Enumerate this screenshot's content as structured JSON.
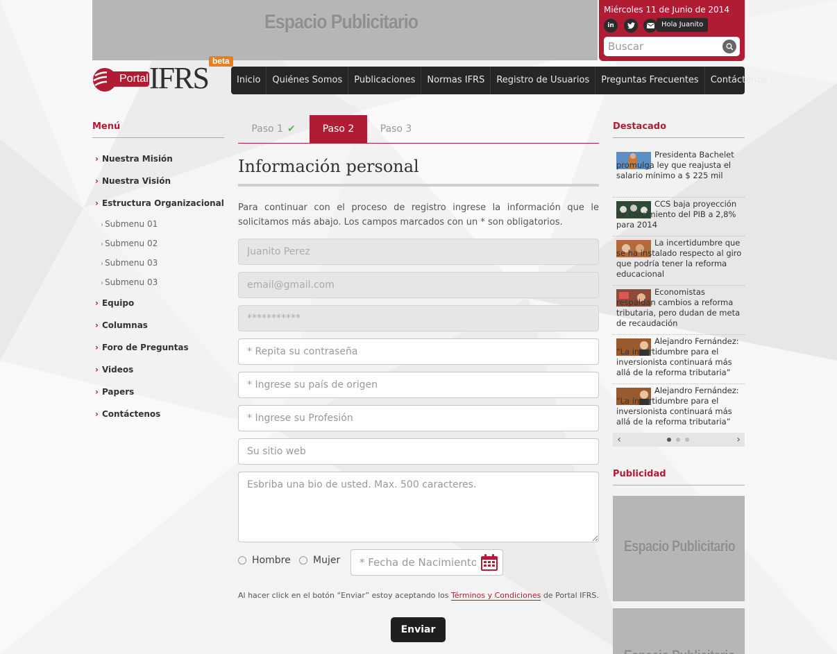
{
  "top_ad": {
    "text": "Espacio Publicitario"
  },
  "user_box": {
    "date": "Miércoles 11 de Junio de 2014",
    "social": [
      "in"
    ],
    "greeting": "Hola Juanito",
    "search_placeholder": "Buscar"
  },
  "logo": {
    "portal": "Portal",
    "ifrs": "IFRS",
    "beta": "beta"
  },
  "nav": [
    "Inicio",
    "Quiénes Somos",
    "Publicaciones",
    "Normas IFRS",
    "Registro de Usuarios",
    "Preguntas Frecuentes",
    "Contáctenos"
  ],
  "sidebar": {
    "heading": "Menú",
    "items": [
      {
        "label": "Nuestra Misión",
        "sub": false
      },
      {
        "label": "Nuestra Visión",
        "sub": false
      },
      {
        "label": "Estructura Organizacional",
        "sub": false
      },
      {
        "label": "Submenu 01",
        "sub": true
      },
      {
        "label": "Submenu 02",
        "sub": true
      },
      {
        "label": "Submenu 03",
        "sub": true
      },
      {
        "label": "Submenu 03",
        "sub": true
      },
      {
        "label": "Equipo",
        "sub": false
      },
      {
        "label": "Columnas",
        "sub": false
      },
      {
        "label": "Foro de Preguntas",
        "sub": false
      },
      {
        "label": "Videos",
        "sub": false
      },
      {
        "label": "Papers",
        "sub": false
      },
      {
        "label": "Contáctenos",
        "sub": false
      }
    ]
  },
  "steps": [
    {
      "label": "Paso 1",
      "done": true,
      "active": false
    },
    {
      "label": "Paso 2",
      "done": false,
      "active": true
    },
    {
      "label": "Paso 3",
      "done": false,
      "active": false
    }
  ],
  "form": {
    "title": "Información personal",
    "intro": "Para continuar con el proceso de registro ingrese la información que le solicitamos más abajo. Los campos marcados con un * son obligatorios.",
    "name_value": "Juanito Perez",
    "email_value": "email@gmail.com",
    "password_value": "***********",
    "repeat_password_placeholder": "* Repita su contraseña",
    "country_placeholder": "* Ingrese su país de origen",
    "profession_placeholder": "* Ingrese su Profesión",
    "website_placeholder": "Su sitio web",
    "bio_placeholder": "Esbriba una bio de usted. Max. 500 caracteres.",
    "gender_male": "Hombre",
    "gender_female": "Mujer",
    "birthdate_placeholder": "* Fecha de Nacimiento",
    "terms_prefix": "Al hacer click en el botón “Enviar” estoy aceptando los",
    "terms_link": "Términos y Condiciones",
    "terms_suffix": "de Portal IFRS.",
    "submit_label": "Enviar"
  },
  "right": {
    "featured_heading": "Destacado",
    "news": [
      {
        "text": "Presidenta Bachelet promulga ley que reajusta el salario mínimo a $ 225 mil"
      },
      {
        "text": "CCS baja proyección de crecimiento del PIB a 2,8% para 2014"
      },
      {
        "text": "La incertidumbre que se ha instalado respecto al giro que podría tener la reforma educacional"
      },
      {
        "text": "Economistas respaldan cambios a reforma tributaria, pero dudan de meta de recaudación"
      },
      {
        "text": "Alejandro Fernández: “La incertidumbre para el inversionista continuará más allá de la reforma tributaria”"
      },
      {
        "text": "Alejandro Fernández: “La incertidumbre para el inversionista continuará más allá de la reforma tributaria”"
      }
    ],
    "carousel_prev": "‹",
    "carousel_next": "›",
    "ads_heading": "Publicidad",
    "ad_text": "Espacio Publicitario"
  },
  "colors": {
    "brand": "#b01c33",
    "nav_bg": "#262626",
    "ad_bg": "#b6b6b6"
  }
}
